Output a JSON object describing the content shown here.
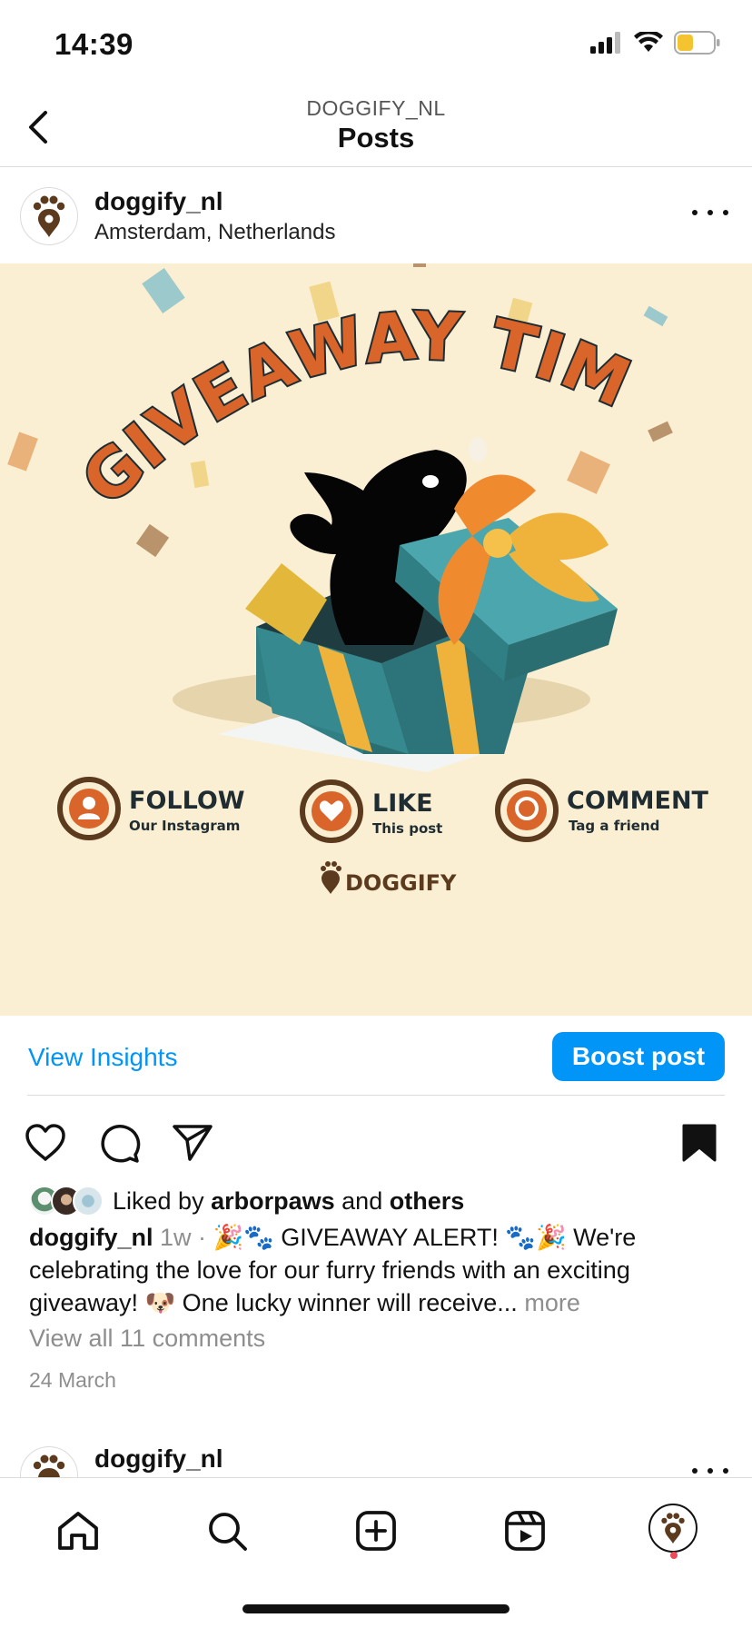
{
  "status_bar": {
    "time": "14:39"
  },
  "header": {
    "account": "DOGGIFY_NL",
    "title": "Posts"
  },
  "post": {
    "username": "doggify_nl",
    "location": "Amsterdam, Netherlands",
    "image": {
      "headline": "GIVEAWAY TIME!",
      "steps": [
        {
          "title": "FOLLOW",
          "subtitle": "Our Instagram"
        },
        {
          "title": "LIKE",
          "subtitle": "This post"
        },
        {
          "title": "COMMENT",
          "subtitle": "Tag a friend"
        }
      ],
      "brand": "DOGGIFY"
    },
    "view_insights": "View Insights",
    "boost_post": "Boost post",
    "likes": {
      "prefix": "Liked by",
      "user": "arborpaws",
      "joiner": "and",
      "others": "others"
    },
    "caption": {
      "username": "doggify_nl",
      "age": "1w",
      "separator": "·",
      "headline": "🎉🐾 GIVEAWAY ALERT! 🐾🎉",
      "body": "We're celebrating the love for our furry friends with an exciting giveaway! 🐶 One lucky winner will receive...",
      "more": "more"
    },
    "view_comments": "View all 11 comments",
    "date": "24 March"
  },
  "next_post": {
    "username": "doggify_nl"
  },
  "colors": {
    "accent_blue": "#0095f6",
    "image_background": "#fbefd3",
    "brand_brown": "#5c3a1e",
    "giveaway_orange": "#d9652a",
    "box_teal": "#2f7f84",
    "ribbon_yellow": "#efb23b"
  },
  "tab_bar": {
    "icons": [
      "home-icon",
      "search-icon",
      "create-icon",
      "reels-icon",
      "profile-avatar"
    ]
  }
}
